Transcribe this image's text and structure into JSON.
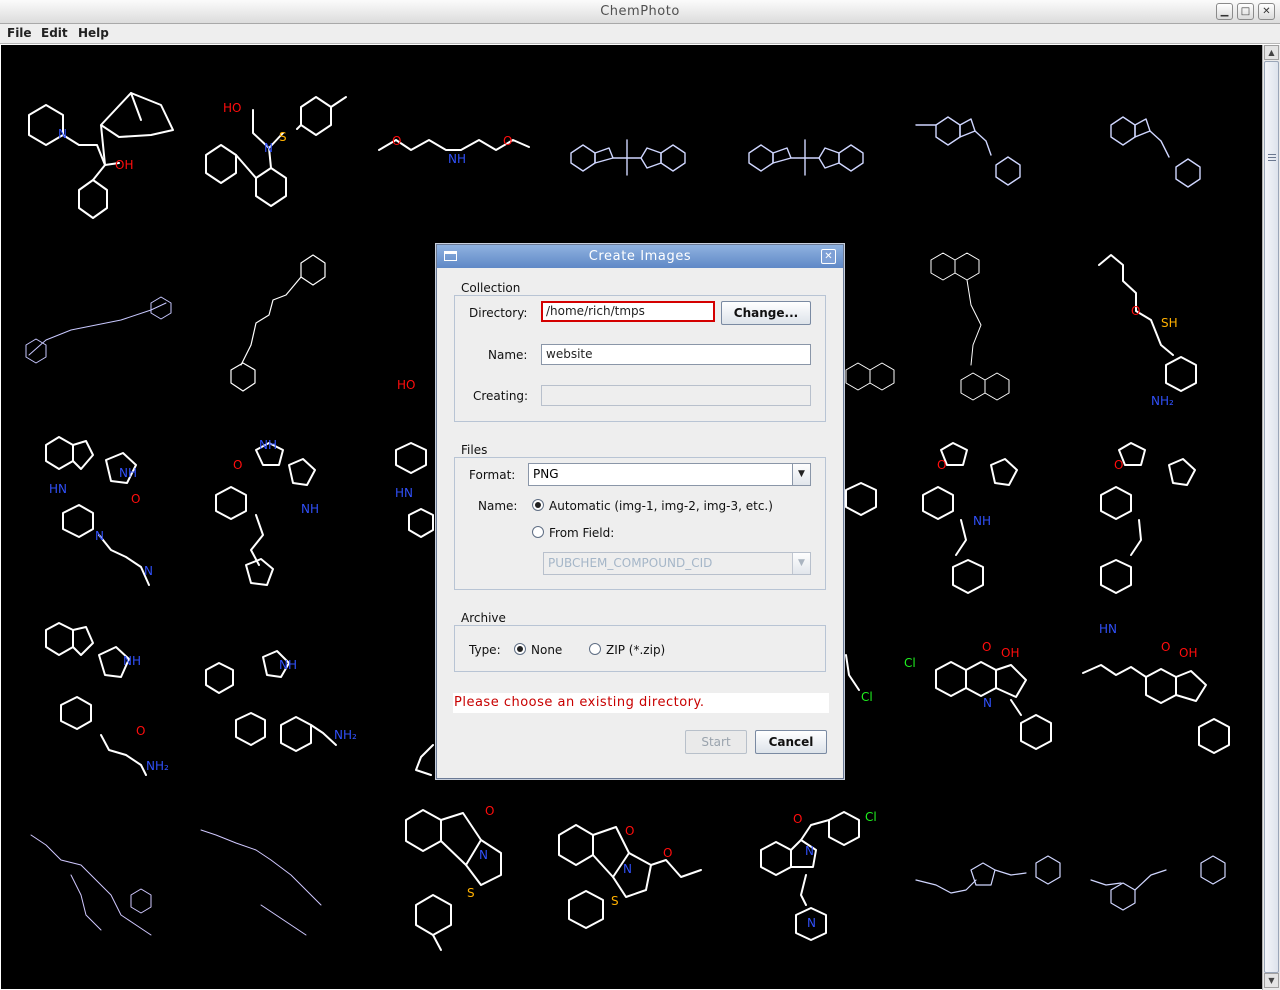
{
  "window": {
    "title": "ChemPhoto",
    "minimize_glyph": "▁",
    "maximize_glyph": "□",
    "close_glyph": "✕"
  },
  "menubar": {
    "items": [
      "File",
      "Edit",
      "Help"
    ]
  },
  "molecule_labels": {
    "hydroxyl": "OH",
    "nitrogen": "N",
    "amine": "NH",
    "oxygen": "O",
    "sulfur": "S",
    "chlorine": "Cl",
    "thiol": "SH",
    "amine2": "NH₂",
    "hydroxyl_acid": "HO",
    "hetero_n": "HN"
  },
  "dialog": {
    "title": "Create Images",
    "close_glyph": "✕",
    "collection": {
      "group_label": "Collection",
      "directory_label": "Directory:",
      "directory_value": "/home/rich/tmps",
      "change_button": "Change...",
      "name_label": "Name:",
      "name_value": "website",
      "creating_label": "Creating:",
      "creating_value": ""
    },
    "files": {
      "group_label": "Files",
      "format_label": "Format:",
      "format_value": "PNG",
      "name_label": "Name:",
      "automatic_label": "Automatic (img-1, img-2, img-3, etc.)",
      "from_field_label": "From Field:",
      "field_value": "PUBCHEM_COMPOUND_CID",
      "selected": "automatic"
    },
    "archive": {
      "group_label": "Archive",
      "type_label": "Type:",
      "none_label": "None",
      "zip_label": "ZIP (*.zip)",
      "selected": "none"
    },
    "error_message": "Please choose an existing directory.",
    "start_button": "Start",
    "cancel_button": "Cancel"
  },
  "colors": {
    "bond": "#ffffff",
    "nitrogen": "#3050f8",
    "oxygen": "#ff0d0d",
    "sulfur": "#ffb000",
    "chlorine": "#1ff01f",
    "error_text": "#c80000",
    "dialog_title_bg": "#6f96d0"
  }
}
